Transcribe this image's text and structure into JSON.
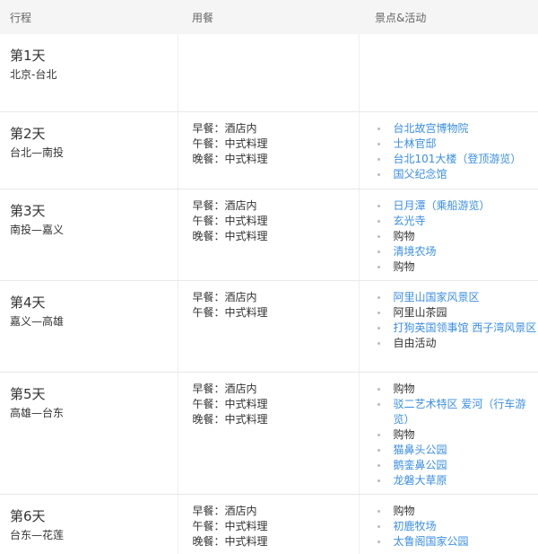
{
  "header": {
    "col1": "行程",
    "col2": "用餐",
    "col3": "景点&活动"
  },
  "days": [
    {
      "title": "第1天",
      "route": "北京-台北",
      "meals": [],
      "spots": []
    },
    {
      "title": "第2天",
      "route": "台北—南投",
      "meals": [
        "早餐：酒店内",
        "午餐：中式料理",
        "晚餐：中式料理"
      ],
      "spots": [
        {
          "text": "台北故宫博物院",
          "link": true
        },
        {
          "text": "士林官邸",
          "link": true
        },
        {
          "text": "台北101大楼（登顶游览）",
          "link": true
        },
        {
          "text": "国父纪念馆",
          "link": true
        }
      ]
    },
    {
      "title": "第3天",
      "route": "南投—嘉义",
      "meals": [
        "早餐：酒店内",
        "午餐：中式料理",
        "晚餐：中式料理"
      ],
      "spots": [
        {
          "text": "日月潭（乘船游览）",
          "link": true
        },
        {
          "text": "玄光寺",
          "link": true
        },
        {
          "text": "购物",
          "link": false
        },
        {
          "text": "清境农场",
          "link": true
        },
        {
          "text": "购物",
          "link": false
        }
      ]
    },
    {
      "title": "第4天",
      "route": "嘉义—高雄",
      "meals": [
        "早餐：酒店内",
        "午餐：中式料理"
      ],
      "spots": [
        {
          "text": "阿里山国家风景区",
          "link": true
        },
        {
          "text": "阿里山茶园",
          "link": false
        },
        {
          "text": "打狗英国领事馆 西子湾风景区",
          "link": true
        },
        {
          "text": "自由活动",
          "link": false
        }
      ]
    },
    {
      "title": "第5天",
      "route": "高雄—台东",
      "meals": [
        "早餐：酒店内",
        "午餐：中式料理",
        "晚餐：中式料理"
      ],
      "spots": [
        {
          "text": "购物",
          "link": false
        },
        {
          "text": "驳二艺术特区 爱河（行车游览）",
          "link": true
        },
        {
          "text": "购物",
          "link": false
        },
        {
          "text": "猫鼻头公园",
          "link": true
        },
        {
          "text": "鹅銮鼻公园",
          "link": true
        },
        {
          "text": "龙磐大草原",
          "link": true
        }
      ]
    },
    {
      "title": "第6天",
      "route": "台东—花莲",
      "meals": [
        "早餐：酒店内",
        "午餐：中式料理",
        "晚餐：中式料理"
      ],
      "spots": [
        {
          "text": "购物",
          "link": false
        },
        {
          "text": "初鹿牧场",
          "link": true
        },
        {
          "text": "太鲁阁国家公园",
          "link": true
        }
      ]
    }
  ]
}
